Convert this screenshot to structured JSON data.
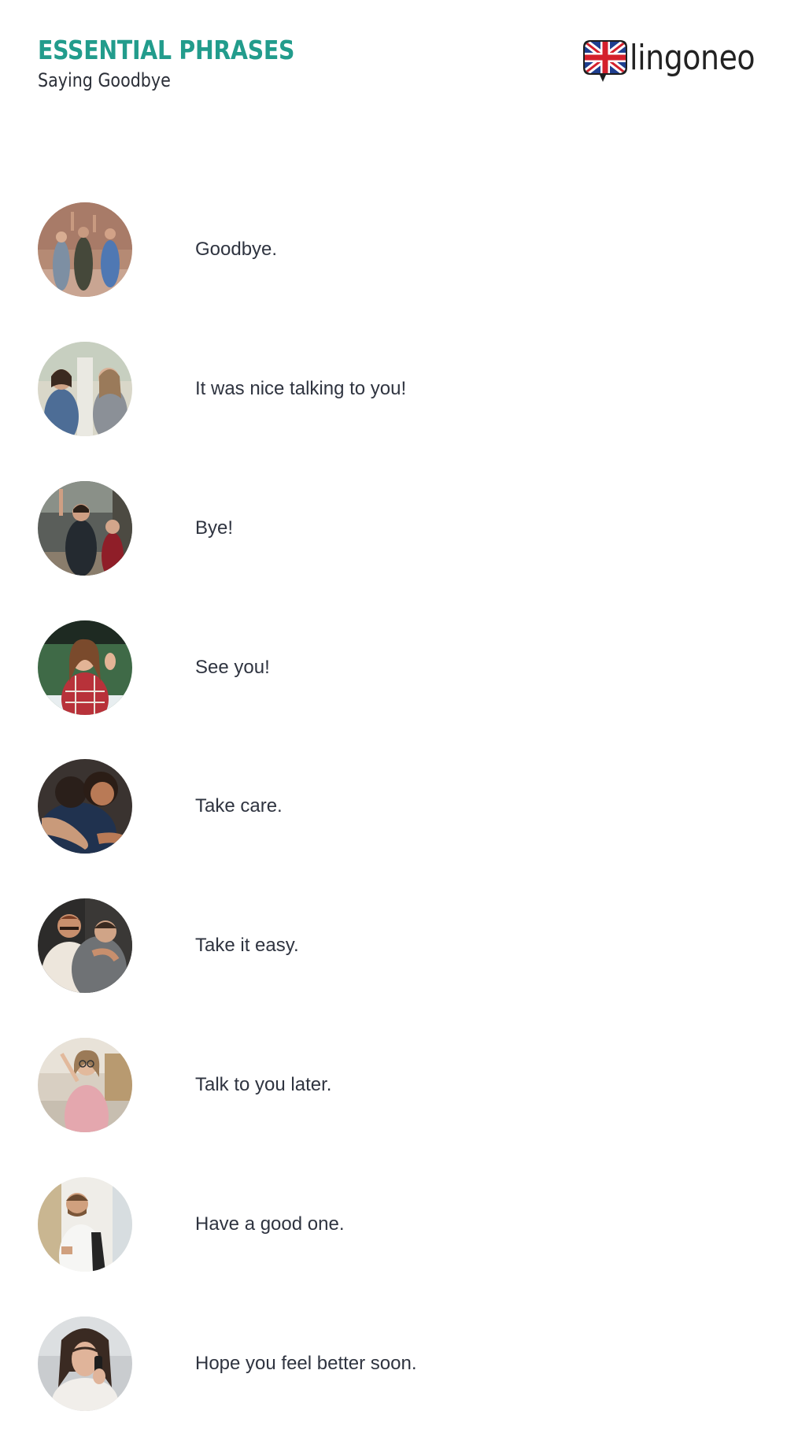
{
  "header": {
    "title": "ESSENTIAL PHRASES",
    "subtitle": "Saying Goodbye"
  },
  "logo": {
    "text": "lingoneo",
    "flag_icon": "uk-flag-speech-bubble-icon"
  },
  "colors": {
    "accent": "#229c8c",
    "text": "#2f3440"
  },
  "phrases": [
    {
      "text": "Goodbye.",
      "photo": "three friends waving"
    },
    {
      "text": "It was nice talking to you!",
      "photo": "two women greeting"
    },
    {
      "text": "Bye!",
      "photo": "couple waving at station"
    },
    {
      "text": "See you!",
      "photo": "woman waving"
    },
    {
      "text": "Take care.",
      "photo": "people hugging"
    },
    {
      "text": "Take it easy.",
      "photo": "men hugging"
    },
    {
      "text": "Talk to you later.",
      "photo": "woman waving in station"
    },
    {
      "text": "Have a good one.",
      "photo": "smiling man with backpack"
    },
    {
      "text": "Hope you feel better soon.",
      "photo": "woman on phone"
    }
  ]
}
